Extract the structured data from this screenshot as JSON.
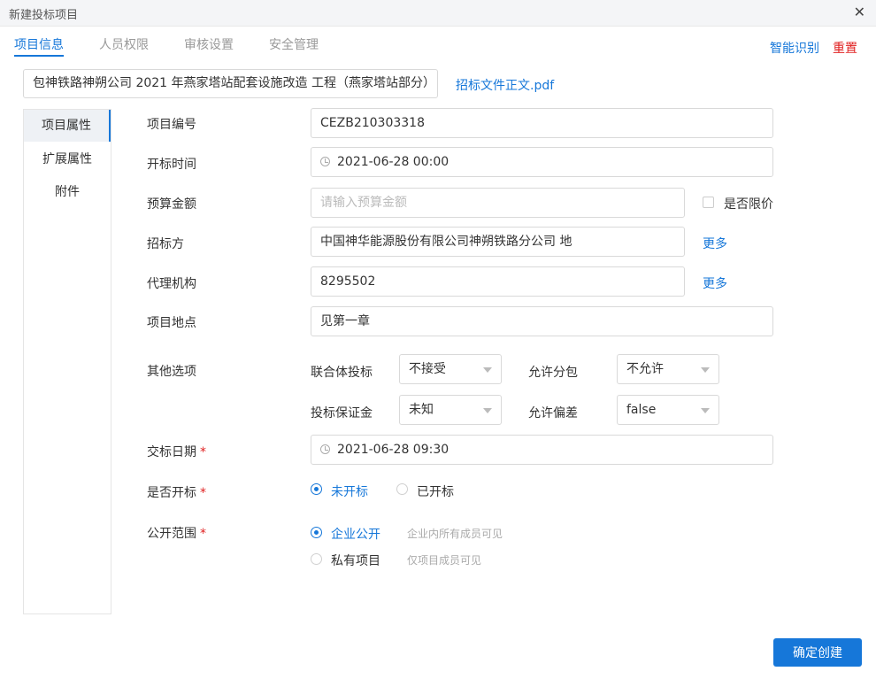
{
  "window": {
    "title": "新建投标项目"
  },
  "tabs": [
    {
      "label": "项目信息"
    },
    {
      "label": "人员权限"
    },
    {
      "label": "审核设置"
    },
    {
      "label": "安全管理"
    }
  ],
  "header_actions": {
    "smart_recognize": "智能识别",
    "reset": "重置"
  },
  "project_name": "包神铁路神朔公司 2021 年燕家塔站配套设施改造 工程（燕家塔站部分）",
  "attachment_link": "招标文件正文.pdf",
  "sidebar": {
    "items": [
      {
        "label": "项目属性"
      },
      {
        "label": "扩展属性"
      },
      {
        "label": "附件"
      }
    ]
  },
  "form": {
    "project_no": {
      "label": "项目编号",
      "value": "CEZB210303318"
    },
    "bid_open_time": {
      "label": "开标时间",
      "value": "2021-06-28 00:00"
    },
    "budget": {
      "label": "预算金额",
      "placeholder": "请输入预算金额",
      "limit_label": "是否限价"
    },
    "tenderer": {
      "label": "招标方",
      "value": "中国神华能源股份有限公司神朔铁路分公司 地",
      "more": "更多"
    },
    "agency": {
      "label": "代理机构",
      "value": "8295502",
      "more": "更多"
    },
    "location": {
      "label": "项目地点",
      "value": "见第一章"
    },
    "other_options": {
      "label": "其他选项",
      "consortium": {
        "label": "联合体投标",
        "value": "不接受"
      },
      "subcontract": {
        "label": "允许分包",
        "value": "不允许"
      },
      "bond": {
        "label": "投标保证金",
        "value": "未知"
      },
      "deviation": {
        "label": "允许偏差",
        "value": "false"
      }
    },
    "submit_date": {
      "label": "交标日期",
      "required": "*",
      "value": "2021-06-28 09:30"
    },
    "opened": {
      "label": "是否开标",
      "required": "*",
      "options": [
        {
          "label": "未开标"
        },
        {
          "label": "已开标"
        }
      ]
    },
    "visibility": {
      "label": "公开范围",
      "required": "*",
      "options": [
        {
          "label": "企业公开",
          "hint": "企业内所有成员可见"
        },
        {
          "label": "私有项目",
          "hint": "仅项目成员可见"
        }
      ]
    }
  },
  "confirm_button": "确定创建"
}
